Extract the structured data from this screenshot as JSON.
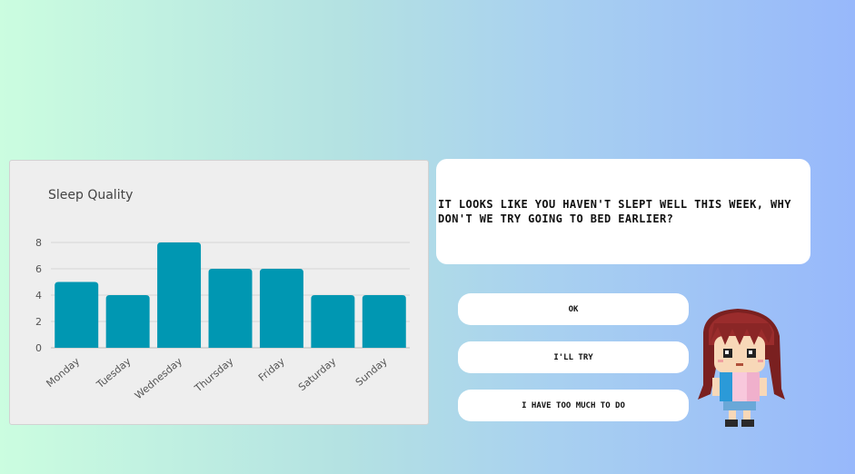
{
  "chart_data": {
    "type": "bar",
    "title": "Sleep Quality",
    "categories": [
      "Monday",
      "Tuesday",
      "Wednesday",
      "Thursday",
      "Friday",
      "Saturday",
      "Sunday"
    ],
    "values": [
      5,
      4,
      8,
      6,
      6,
      4,
      4
    ],
    "yticks": [
      0,
      2,
      4,
      6,
      8
    ],
    "ylim": [
      0,
      8
    ],
    "xlabel": "",
    "ylabel": "",
    "grid": true,
    "bar_color": "#0097b2"
  },
  "dialog": {
    "message": "It looks like you haven't slept well this week, why don't we try going to bed earlier?"
  },
  "choices": {
    "ok": "OK",
    "try": "I'll try",
    "too_much": "I have too much to do"
  },
  "avatar": {
    "icon": "pixel-girl-character"
  },
  "colors": {
    "button_bg": "#ffffff",
    "text": "#111111"
  }
}
